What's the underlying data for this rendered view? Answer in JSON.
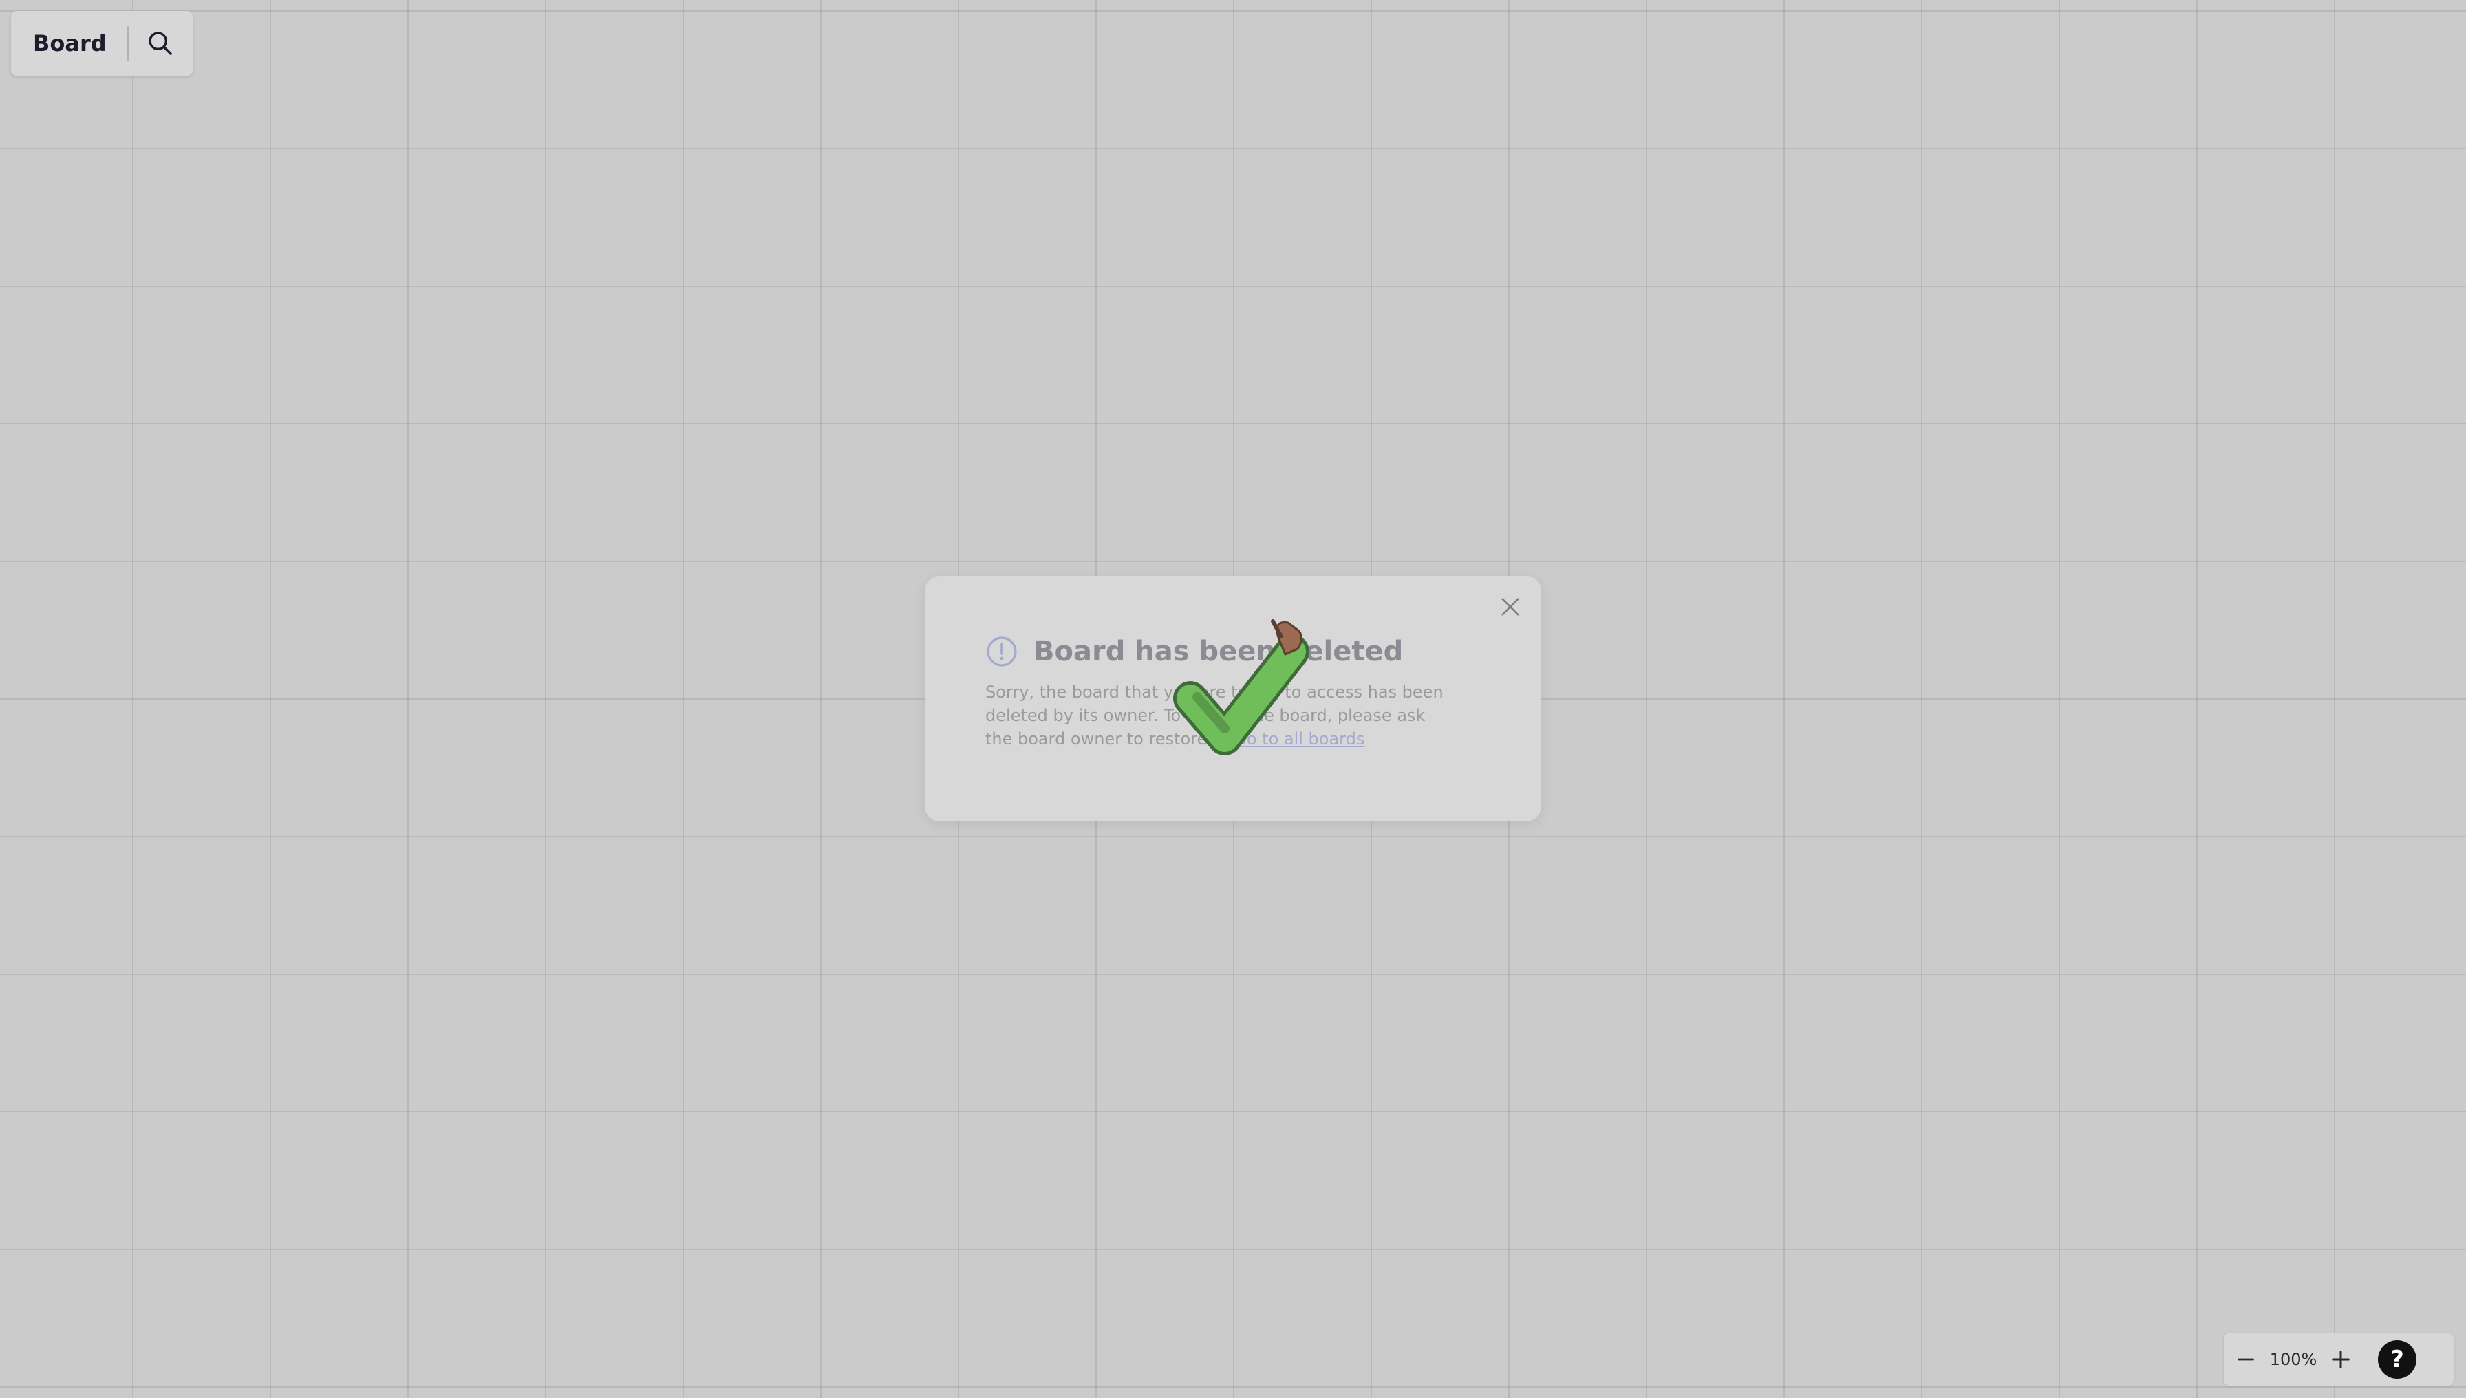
{
  "topbar": {
    "board_name": "Board",
    "search_icon": "search-icon"
  },
  "dialog": {
    "icon": "exclamation-circle-icon",
    "title": "Board has been deleted",
    "body": "Sorry, the board that you are trying to access has been deleted by its owner. To access the board, please ask the board owner to restore it.",
    "link": "Go to all boards",
    "close_icon": "close-icon"
  },
  "zoom": {
    "level": "100%",
    "out_icon": "minus-icon",
    "in_icon": "plus-icon",
    "help_label": "?"
  },
  "overlay": {
    "icon": "checkmark-icon"
  },
  "colors": {
    "canvas": "#cbcbcb",
    "dialog_bg": "#d8d8d8",
    "link": "#a3a9cf",
    "check_green": "#6fbe5a"
  }
}
